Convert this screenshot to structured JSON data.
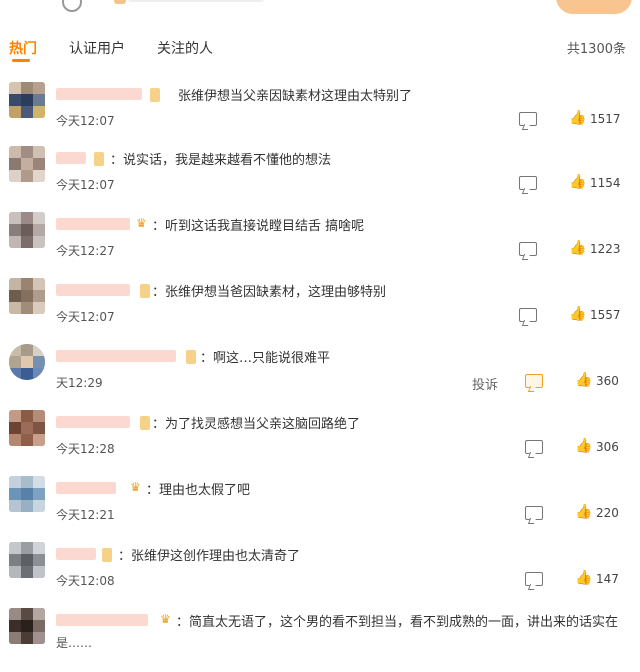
{
  "tabs": [
    {
      "label": "热门"
    },
    {
      "label": "认证用户"
    },
    {
      "label": "关注的人"
    }
  ],
  "total_count": "共1300条",
  "colors": {
    "accent": "#ff8200"
  },
  "comments": [
    {
      "text": "张维伊想当父亲因缺素材这理由太特别了",
      "time": "今天12:07",
      "likes": "1517"
    },
    {
      "text": "：说实话，我是越来越看不懂他的想法",
      "time": "今天12:07",
      "likes": "1154"
    },
    {
      "text": "：听到这话我直接说瞠目结舌 搞啥呢",
      "time": "今天12:27",
      "likes": "1223"
    },
    {
      "text": "：张维伊想当爸因缺素材，这理由够特别",
      "time": "今天12:07",
      "likes": "1557"
    },
    {
      "text": "：啊这…只能说很难平",
      "time": "天12:29",
      "likes": "360",
      "report": "投诉"
    },
    {
      "text": "：为了找灵感想当父亲这脑回路绝了",
      "time": "今天12:28",
      "likes": "306"
    },
    {
      "text": "：理由也太假了吧",
      "time": "今天12:21",
      "likes": "220"
    },
    {
      "text": "：张维伊这创作理由也太清奇了",
      "time": "今天12:08",
      "likes": "147"
    },
    {
      "text": "：简直太无语了，这个男的看不到担当，看不到成熟的一面，讲出来的话实在",
      "time": "是……",
      "likes": ""
    }
  ]
}
